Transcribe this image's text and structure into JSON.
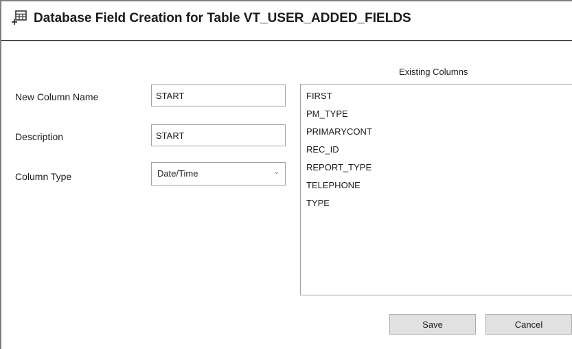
{
  "window": {
    "title": "Database Field Creation for Table VT_USER_ADDED_FIELDS",
    "title_icon": "table-add-icon"
  },
  "form": {
    "new_column_name": {
      "label": "New Column Name",
      "value": "START"
    },
    "description": {
      "label": "Description",
      "value": "START"
    },
    "column_type": {
      "label": "Column Type",
      "value": "Date/Time",
      "icon": "chevron-down-icon"
    }
  },
  "existing_columns": {
    "title": "Existing Columns",
    "items": [
      "FIRST",
      "PM_TYPE",
      "PRIMARYCONT",
      "REC_ID",
      "REPORT_TYPE",
      "TELEPHONE",
      "TYPE"
    ]
  },
  "buttons": {
    "save": "Save",
    "cancel": "Cancel"
  },
  "colors": {
    "title_border": "#4d4d4d",
    "button_bg": "#e1e1e1",
    "field_border": "#a0a0a0"
  }
}
